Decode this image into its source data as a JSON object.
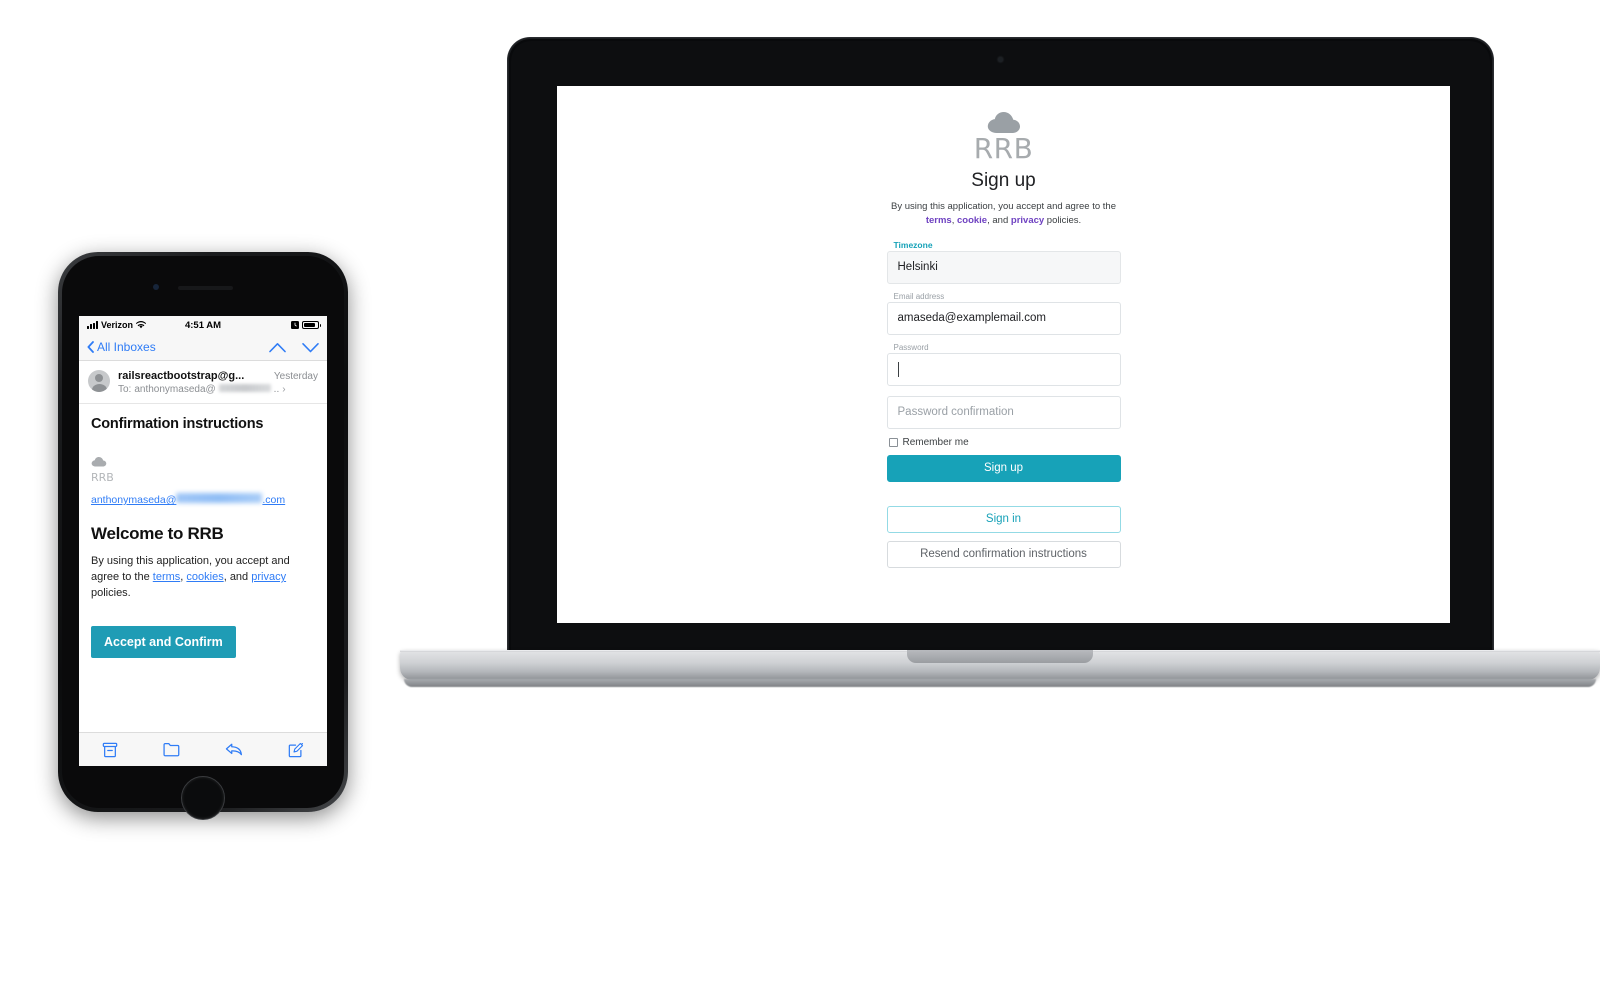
{
  "desktop": {
    "brand": {
      "logo_text": "RRB",
      "icon": "cloud-icon"
    },
    "title": "Sign up",
    "legal": {
      "lead": "By using this application, you accept and agree to the",
      "terms": "terms",
      "sep1": ", ",
      "cookie": "cookie",
      "sep2": ", and ",
      "privacy": "privacy",
      "tail": " policies."
    },
    "fields": [
      {
        "label": "Timezone",
        "value": "Helsinki",
        "placeholder": "",
        "label_active": true
      },
      {
        "label": "Email address",
        "value": "amaseda@examplemail.com",
        "placeholder": "",
        "label_active": false
      },
      {
        "label": "Password",
        "value": "",
        "placeholder": "",
        "label_active": false
      },
      {
        "label": "",
        "value": "",
        "placeholder": "Password confirmation",
        "label_active": false
      }
    ],
    "remember_label": "Remember me",
    "buttons": {
      "signup": "Sign up",
      "signin": "Sign in",
      "resend": "Resend confirmation instructions"
    },
    "colors": {
      "accent": "#17a2b8",
      "link": "#6f42c1",
      "label_muted": "#9aa0a6"
    }
  },
  "phone": {
    "status": {
      "carrier": "Verizon",
      "time": "4:51 AM",
      "wifi": "wifi-icon",
      "alarm": "alarm-icon",
      "battery": "battery-icon"
    },
    "nav": {
      "back": "All Inboxes",
      "up": "chevron-up-icon",
      "down": "chevron-down-icon"
    },
    "mail_header": {
      "from": "railsreactbootstrap@g...",
      "date": "Yesterday",
      "to_prefix": "To:",
      "to": "anthonymaseda@",
      "to_suffix": "..",
      "chevron": "chevron-right-icon"
    },
    "body": {
      "subject": "Confirmation instructions",
      "logo_text": "RRB",
      "recipient_prefix": "anthonymaseda@",
      "recipient_suffix": ".com",
      "welcome": "Welcome to RRB",
      "legal_lead": "By using this application, you accept and agree to the",
      "terms": "terms",
      "sep1": ", ",
      "cookies": "cookies",
      "sep2": ", and ",
      "privacy": "privacy",
      "legal_tail": " policies.",
      "cta": "Accept and Confirm"
    },
    "toolbar": [
      {
        "name": "archive-icon"
      },
      {
        "name": "folder-icon"
      },
      {
        "name": "reply-icon"
      },
      {
        "name": "compose-icon"
      }
    ],
    "colors": {
      "ios_blue": "#2f7cf6",
      "accent": "#1f9cb5"
    }
  }
}
